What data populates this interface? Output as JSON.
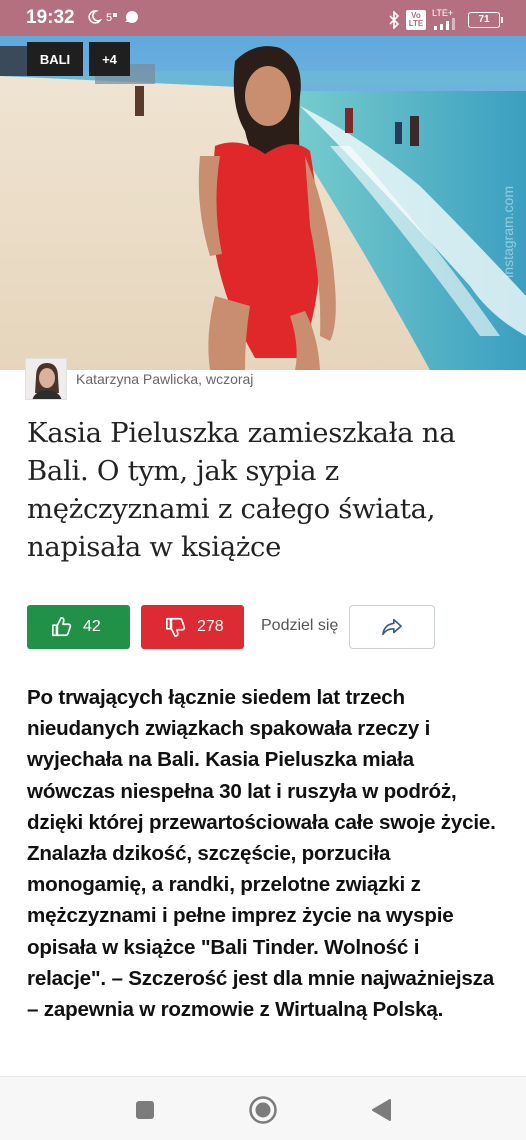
{
  "status_bar": {
    "time": "19:32",
    "network": "LTE+",
    "volte": "Vo LTE",
    "battery": "71"
  },
  "hero": {
    "tags": [
      "BALI",
      "+4"
    ],
    "watermark": "instagram.com"
  },
  "author": {
    "name": "Katarzyna Pawlicka",
    "when": "wczoraj"
  },
  "article": {
    "headline": "Kasia Pieluszka zamieszkała na Bali. O tym, jak sypia z mężczyznami z całego świata, napisała w książce",
    "lead": "Po trwających łącznie siedem lat trzech nieudanych związkach spakowała rzeczy i wyjechała na Bali. Kasia Pieluszka miała wówczas niespełna 30 lat i ruszyła w podróż, dzięki której przewartościowała całe swoje życie. Znalazła dzikość, szczęście, porzuciła monogamię, a randki, przelotne związki z mężczyznami i pełne imprez życie na wyspie opisała w książce \"Bali Tinder. Wolność i relacje\". – Szczerość jest dla mnie najważniejsza – zapewnia w rozmowie z Wirtualną Polską."
  },
  "actions": {
    "likes": "42",
    "dislikes": "278",
    "share_label": "Podziel się"
  },
  "colors": {
    "status_bar": "#b4707e",
    "like": "#219147",
    "dislike": "#dd2b33"
  }
}
